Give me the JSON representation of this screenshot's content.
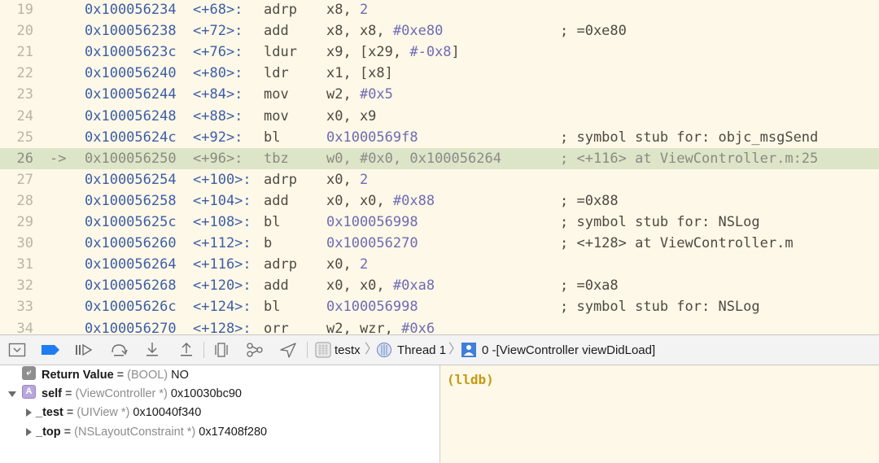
{
  "disassembly": [
    {
      "line": "19",
      "arrow": "",
      "addr": "0x100056234",
      "offset": "<+68>:",
      "mnemonic": "adrp",
      "op": "x8, ",
      "op_lit": "2",
      "op_tail": "",
      "comment": ""
    },
    {
      "line": "20",
      "arrow": "",
      "addr": "0x100056238",
      "offset": "<+72>:",
      "mnemonic": "add",
      "op": "x8, x8, ",
      "op_lit": "#0xe80",
      "op_tail": "",
      "comment": "; =0xe80"
    },
    {
      "line": "21",
      "arrow": "",
      "addr": "0x10005623c",
      "offset": "<+76>:",
      "mnemonic": "ldur",
      "op": "x9, [x29, ",
      "op_lit": "#-0x8",
      "op_tail": "]",
      "comment": ""
    },
    {
      "line": "22",
      "arrow": "",
      "addr": "0x100056240",
      "offset": "<+80>:",
      "mnemonic": "ldr",
      "op": "x1, [x8]",
      "op_lit": "",
      "op_tail": "",
      "comment": ""
    },
    {
      "line": "23",
      "arrow": "",
      "addr": "0x100056244",
      "offset": "<+84>:",
      "mnemonic": "mov",
      "op": "w2, ",
      "op_lit": "#0x5",
      "op_tail": "",
      "comment": ""
    },
    {
      "line": "24",
      "arrow": "",
      "addr": "0x100056248",
      "offset": "<+88>:",
      "mnemonic": "mov",
      "op": "x0, x9",
      "op_lit": "",
      "op_tail": "",
      "comment": ""
    },
    {
      "line": "25",
      "arrow": "",
      "addr": "0x10005624c",
      "offset": "<+92>:",
      "mnemonic": "bl",
      "op": "",
      "op_lit": "0x1000569f8",
      "op_tail": "",
      "comment": "; symbol stub for: objc_msgSend"
    },
    {
      "line": "26",
      "arrow": "->",
      "addr": "0x100056250",
      "offset": "<+96>:",
      "mnemonic": "tbz",
      "op": "w0, ",
      "op_lit": "#0x0, 0x100056264",
      "op_tail": "",
      "comment": "; <+116> at ViewController.m:25",
      "current": true
    },
    {
      "line": "27",
      "arrow": "",
      "addr": "0x100056254",
      "offset": "<+100>:",
      "mnemonic": "adrp",
      "op": "x0, ",
      "op_lit": "2",
      "op_tail": "",
      "comment": ""
    },
    {
      "line": "28",
      "arrow": "",
      "addr": "0x100056258",
      "offset": "<+104>:",
      "mnemonic": "add",
      "op": "x0, x0, ",
      "op_lit": "#0x88",
      "op_tail": "",
      "comment": "; =0x88"
    },
    {
      "line": "29",
      "arrow": "",
      "addr": "0x10005625c",
      "offset": "<+108>:",
      "mnemonic": "bl",
      "op": "",
      "op_lit": "0x100056998",
      "op_tail": "",
      "comment": "; symbol stub for: NSLog"
    },
    {
      "line": "30",
      "arrow": "",
      "addr": "0x100056260",
      "offset": "<+112>:",
      "mnemonic": "b",
      "op": "",
      "op_lit": "0x100056270",
      "op_tail": "",
      "comment": "; <+128> at ViewController.m"
    },
    {
      "line": "31",
      "arrow": "",
      "addr": "0x100056264",
      "offset": "<+116>:",
      "mnemonic": "adrp",
      "op": "x0, ",
      "op_lit": "2",
      "op_tail": "",
      "comment": ""
    },
    {
      "line": "32",
      "arrow": "",
      "addr": "0x100056268",
      "offset": "<+120>:",
      "mnemonic": "add",
      "op": "x0, x0, ",
      "op_lit": "#0xa8",
      "op_tail": "",
      "comment": "; =0xa8"
    },
    {
      "line": "33",
      "arrow": "",
      "addr": "0x10005626c",
      "offset": "<+124>:",
      "mnemonic": "bl",
      "op": "",
      "op_lit": "0x100056998",
      "op_tail": "",
      "comment": "; symbol stub for: NSLog"
    },
    {
      "line": "34",
      "arrow": "",
      "addr": "0x100056270",
      "offset": "<+128>:",
      "mnemonic": "orr",
      "op": "w2, wzr, ",
      "op_lit": "#0x6",
      "op_tail": "",
      "comment": ""
    }
  ],
  "toolbar": {
    "target": "testx",
    "thread": "Thread 1",
    "frame": "0 -[ViewController viewDidLoad]",
    "icons": [
      "hide-debug-area-icon",
      "breakpoints-toggle-icon",
      "continue-icon",
      "step-over-icon",
      "step-into-icon",
      "step-out-icon",
      "view-hierarchy-icon",
      "memory-graph-icon",
      "simulate-location-icon",
      "app-icon",
      "thread-icon",
      "frame-icon"
    ]
  },
  "variables": [
    {
      "icon": "return-value-icon",
      "icon_letter": "⤶",
      "name": "Return Value",
      "eq": " = ",
      "type": "(BOOL)",
      "value": " NO"
    },
    {
      "icon": "class-icon",
      "icon_letter": "A",
      "name": "self",
      "eq": " = ",
      "type": "(ViewController *)",
      "value": " 0x10030bc90"
    },
    {
      "name": "_test",
      "eq": " = ",
      "type": "(UIView *)",
      "value": " 0x10040f340"
    },
    {
      "name": "_top",
      "eq": " = ",
      "type": "(NSLayoutConstraint *)",
      "value": " 0x17408f280"
    }
  ],
  "console": {
    "prompt": "(lldb)"
  },
  "colors": {
    "editor_bg": "#fdf8e7",
    "current_line": "#dde5c8",
    "address": "#3c5ea8",
    "literal": "#6e6bb5",
    "lldb_prompt": "#c49a12"
  }
}
